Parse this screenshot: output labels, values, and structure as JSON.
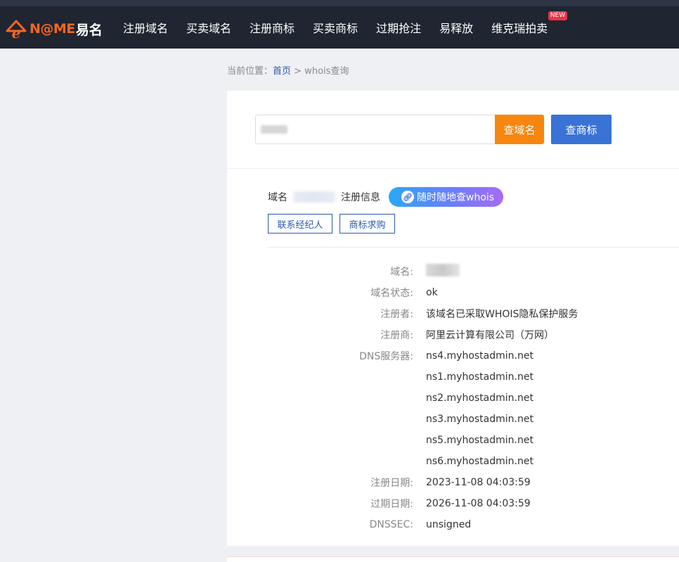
{
  "header": {
    "logo_text": "N@ME",
    "logo_cn": "易名",
    "nav": [
      {
        "label": "注册域名"
      },
      {
        "label": "买卖域名"
      },
      {
        "label": "注册商标"
      },
      {
        "label": "买卖商标"
      },
      {
        "label": "过期抢注"
      },
      {
        "label": "易释放"
      },
      {
        "label": "维克瑞拍卖",
        "badge": "NEW"
      }
    ],
    "colors": {
      "bar": "#1f2531",
      "accent": "#f26722",
      "badge": "#e8344a"
    }
  },
  "breadcrumb": {
    "prefix": "当前位置：",
    "home": "首页",
    "separator": " > ",
    "current": "whois查询"
  },
  "search": {
    "input_value": "",
    "domain_button": "查域名",
    "trademark_button": "查商标",
    "colors": {
      "domain_button": "#f7860f",
      "trademark_button": "#3973d5"
    }
  },
  "info": {
    "head_prefix": "域名",
    "head_suffix": "注册信息",
    "pill_label": "随时随地查whois",
    "pill_icon": "link-icon",
    "contact_button": "联系经纪人",
    "trademark_buy_button": "商标求购",
    "rows": [
      {
        "label": "域名:",
        "value": ""
      },
      {
        "label": "域名状态:",
        "value": "ok"
      },
      {
        "label": "注册者:",
        "value": "该域名已采取WHOIS隐私保护服务"
      },
      {
        "label": "注册商:",
        "value": "阿里云计算有限公司（万网）"
      },
      {
        "label": "DNS服务器:",
        "value": "ns4.myhostadmin.net"
      },
      {
        "label": "",
        "value": "ns1.myhostadmin.net"
      },
      {
        "label": "",
        "value": "ns2.myhostadmin.net"
      },
      {
        "label": "",
        "value": "ns3.myhostadmin.net"
      },
      {
        "label": "",
        "value": "ns5.myhostadmin.net"
      },
      {
        "label": "",
        "value": "ns6.myhostadmin.net"
      },
      {
        "label": "注册日期:",
        "value": "2023-11-08 04:03:59"
      },
      {
        "label": "过期日期:",
        "value": "2026-11-08 04:03:59"
      },
      {
        "label": "DNSSEC:",
        "value": "unsigned"
      }
    ]
  }
}
